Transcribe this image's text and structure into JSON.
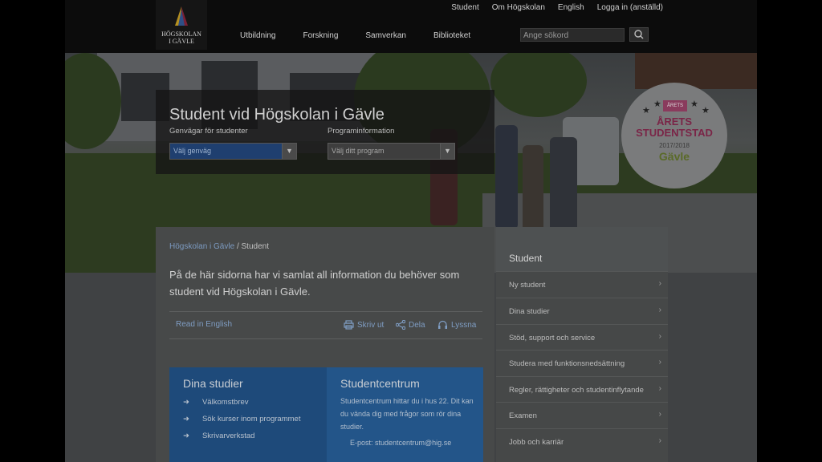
{
  "top_links": [
    "Student",
    "Om Högskolan",
    "English",
    "Logga in (anställd)"
  ],
  "logo": {
    "line1": "HÖGSKOLAN",
    "line2": "I GÄVLE"
  },
  "main_nav": [
    "Utbildning",
    "Forskning",
    "Samverkan",
    "Biblioteket"
  ],
  "search": {
    "placeholder": "Ange sökord"
  },
  "hero": {
    "title": "Student vid Högskolan i Gävle",
    "shortcuts_label": "Genvägar för studenter",
    "shortcuts_value": "Välj genväg",
    "program_label": "Programinformation",
    "program_value": "Välj ditt program"
  },
  "badge": {
    "flag": "ÅRETS",
    "line1": "ÅRETS",
    "line2": "STUDENTSTAD",
    "years": "2017/2018",
    "city": "Gävle"
  },
  "breadcrumb": {
    "home": "Högskolan i Gävle",
    "current": "Student"
  },
  "intro": "På de här sidorna har vi samlat all information du behöver som student vid Högskolan i Gävle.",
  "tools": {
    "read_english": "Read in English",
    "print": "Skriv ut",
    "share": "Dela",
    "listen": "Lyssna"
  },
  "dina_studier": {
    "title": "Dina studier",
    "items": [
      "Välkomstbrev",
      "Sök kurser inom programmet",
      "Skrivarverkstad"
    ]
  },
  "studentcentrum": {
    "title": "Studentcentrum",
    "text": "Studentcentrum hittar du i hus 22. Dit kan du vända dig med frågor som rör dina studier.",
    "email": "E-post: studentcentrum@hig.se"
  },
  "sidebar": {
    "title": "Student",
    "items": [
      "Ny student",
      "Dina studier",
      "Stöd, support och service",
      "Studera med funktionsnedsättning",
      "Regler, rättigheter och studentinflytande",
      "Examen",
      "Jobb och karriär"
    ]
  },
  "colors": {
    "accent": "#1e4a7a",
    "link": "#7c9ac0",
    "badge": "#7a2547"
  }
}
